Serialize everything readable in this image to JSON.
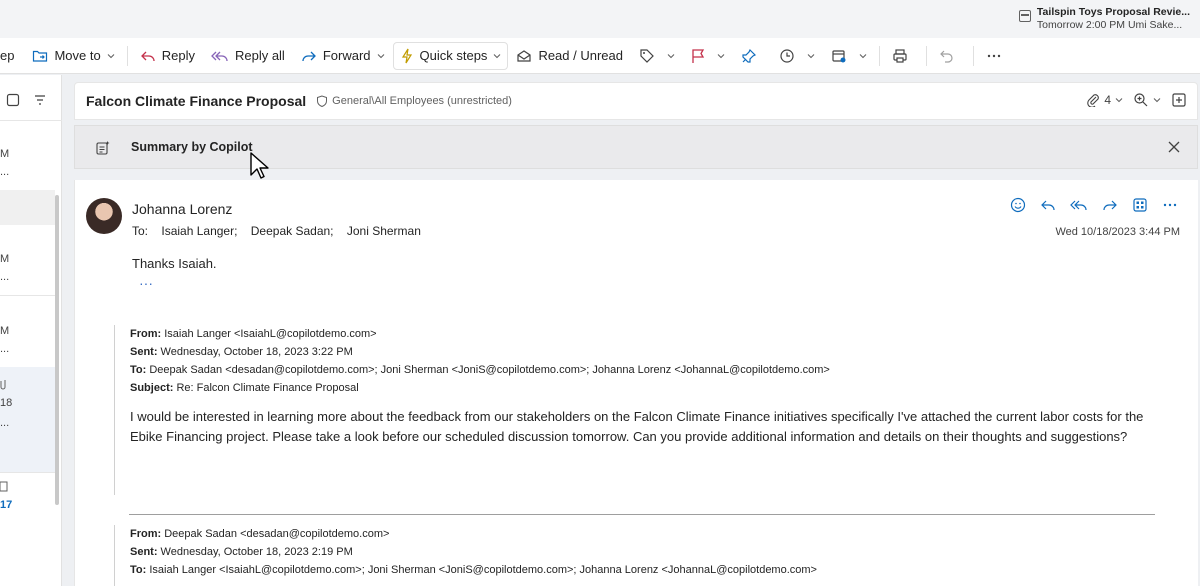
{
  "reminder": {
    "title": "Tailspin Toys Proposal Revie...",
    "detail": "Tomorrow 2:00 PM Umi Sake..."
  },
  "toolbar": {
    "cut_label": "ep",
    "move_to": "Move to",
    "reply": "Reply",
    "reply_all": "Reply all",
    "forward": "Forward",
    "quick_steps": "Quick steps",
    "read_unread": "Read / Unread"
  },
  "left_pane": {
    "items": [
      "M",
      "...",
      "M",
      "...",
      "M",
      "...",
      "18",
      "...",
      "17"
    ]
  },
  "message": {
    "subject": "Falcon Climate Finance Proposal",
    "sensitivity": "General\\All Employees (unrestricted)",
    "attachments_count": "4",
    "copilot_title": "Summary by Copilot",
    "sender": "Johanna Lorenz",
    "to_label": "To:",
    "recipients": [
      "Isaiah Langer;",
      "Deepak Sadan;",
      "Joni Sherman"
    ],
    "date": "Wed 10/18/2023 3:44 PM",
    "body": "Thanks Isaiah.",
    "expand": "···"
  },
  "quoted": [
    {
      "from_label": "From:",
      "from": " Isaiah Langer <IsaiahL@copilotdemo.com>",
      "sent_label": "Sent:",
      "sent": " Wednesday, October 18, 2023 3:22 PM",
      "to_label": "To:",
      "to": " Deepak Sadan <desadan@copilotdemo.com>; Joni Sherman <JoniS@copilotdemo.com>; Johanna Lorenz <JohannaL@copilotdemo.com>",
      "subject_label": "Subject:",
      "subject": " Re: Falcon Climate Finance Proposal",
      "text": "I would be interested in learning more about the feedback from our stakeholders on the Falcon Climate Finance initiatives specifically I've attached the current labor costs for the Ebike Financing project. Please take a look before our scheduled discussion tomorrow. Can you provide additional information and details on their thoughts and suggestions?"
    },
    {
      "from_label": "From:",
      "from": " Deepak Sadan <desadan@copilotdemo.com>",
      "sent_label": "Sent:",
      "sent": " Wednesday, October 18, 2023 2:19 PM",
      "to_label": "To:",
      "to": " Isaiah Langer <IsaiahL@copilotdemo.com>; Joni Sherman <JoniS@copilotdemo.com>; Johanna Lorenz <JohannaL@copilotdemo.com>"
    }
  ],
  "colors": {
    "accent": "#0f6cbd",
    "flag": "#c4314b"
  }
}
